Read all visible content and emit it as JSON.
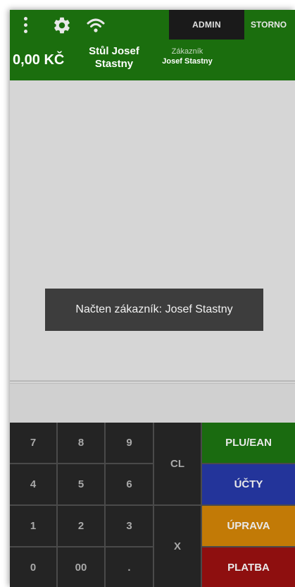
{
  "header": {
    "admin_label": "ADMIN",
    "storno_label": "STORNO",
    "total": "0,00 KČ",
    "table_line1": "Stůl Josef",
    "table_line2": "Stastny",
    "customer_label": "Zákazník",
    "customer_name": "Josef Stastny",
    "icons": [
      "menu-icon",
      "gear-icon",
      "wifi-icon"
    ]
  },
  "toast": {
    "message": "Načten zákazník: Josef Stastny"
  },
  "keypad": {
    "keys": [
      "7",
      "8",
      "9",
      "4",
      "5",
      "6",
      "1",
      "2",
      "3",
      "0",
      "00",
      "."
    ],
    "clear_label": "CL",
    "multiply_label": "X"
  },
  "function_keys": {
    "plu": "PLU/EAN",
    "accounts": "ÚČTY",
    "edit": "ÚPRAVA",
    "payment": "PLATBA"
  },
  "colors": {
    "header_bg": "#1b6e0e",
    "plu_bg": "#1a6b10",
    "accounts_bg": "#23349a",
    "edit_bg": "#c27a06",
    "payment_bg": "#8e0f0f"
  }
}
